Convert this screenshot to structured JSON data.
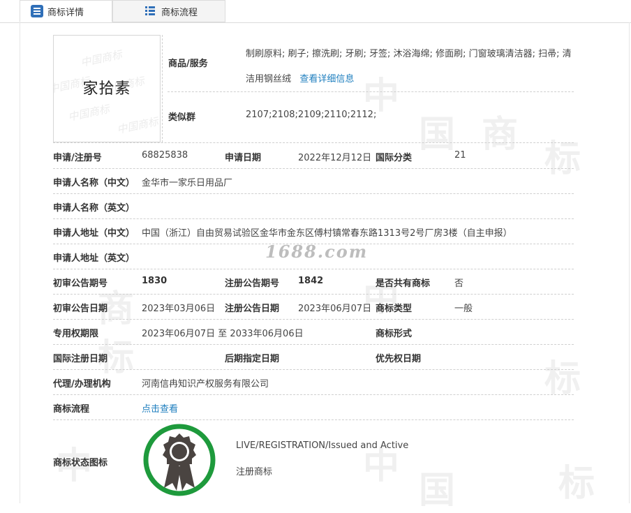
{
  "tabs": [
    {
      "label": "商标详情",
      "icon": "list-icon",
      "active": true
    },
    {
      "label": "商标流程",
      "icon": "grid-list-icon",
      "active": false
    }
  ],
  "watermark": {
    "chars": [
      "中",
      "国",
      "商",
      "标"
    ],
    "site": "1688.com"
  },
  "trademark": {
    "image_text": "家拾素",
    "image_watermark": "中国商标"
  },
  "goods": {
    "label": "商品/服务",
    "text": "制刷原料; 刷子; 擦洗刷; 牙刷; 牙签; 沐浴海绵; 修面刷; 门窗玻璃清洁器; 扫帚; 清洁用钢丝绒",
    "link": "查看详细信息"
  },
  "similar": {
    "label": "类似群",
    "value": "2107;2108;2109;2110;2112;"
  },
  "rows": {
    "reg_no": {
      "label": "申请/注册号",
      "value": "68825838"
    },
    "apply_date": {
      "label": "申请日期",
      "value": "2022年12月12日"
    },
    "intl_class": {
      "label": "国际分类",
      "value": "21"
    },
    "applicant_cn": {
      "label": "申请人名称（中文）",
      "value": "金华市一家乐日用品厂"
    },
    "applicant_en": {
      "label": "申请人名称（英文）",
      "value": ""
    },
    "address_cn": {
      "label": "申请人地址（中文）",
      "value": "中国（浙江）自由贸易试验区金华市金东区傅村镇常春东路1313号2号厂房3楼（自主申报）"
    },
    "address_en": {
      "label": "申请人地址（英文）",
      "value": ""
    },
    "prelim_issue": {
      "label": "初审公告期号",
      "value": "1830"
    },
    "reg_issue": {
      "label": "注册公告期号",
      "value": "1842"
    },
    "shared": {
      "label": "是否共有商标",
      "value": "否"
    },
    "prelim_date": {
      "label": "初审公告日期",
      "value": "2023年03月06日"
    },
    "reg_date": {
      "label": "注册公告日期",
      "value": "2023年06月07日"
    },
    "tm_type": {
      "label": "商标类型",
      "value": "一般"
    },
    "exclusive": {
      "label": "专用权期限",
      "value": "2023年06月07日 至 2033年06月06日"
    },
    "tm_form": {
      "label": "商标形式",
      "value": ""
    },
    "intl_reg_date": {
      "label": "国际注册日期",
      "value": ""
    },
    "later_date": {
      "label": "后期指定日期",
      "value": ""
    },
    "priority_date": {
      "label": "优先权日期",
      "value": ""
    },
    "agent": {
      "label": "代理/办理机构",
      "value": "河南信冉知识产权服务有限公司"
    },
    "flow": {
      "label": "商标流程",
      "value": "点击查看"
    }
  },
  "status": {
    "label": "商标状态图标",
    "line1": "LIVE/REGISTRATION/Issued and Active",
    "line2": "注册商标",
    "ring_color": "#1e9a3c",
    "badge_color": "#4a4441"
  }
}
